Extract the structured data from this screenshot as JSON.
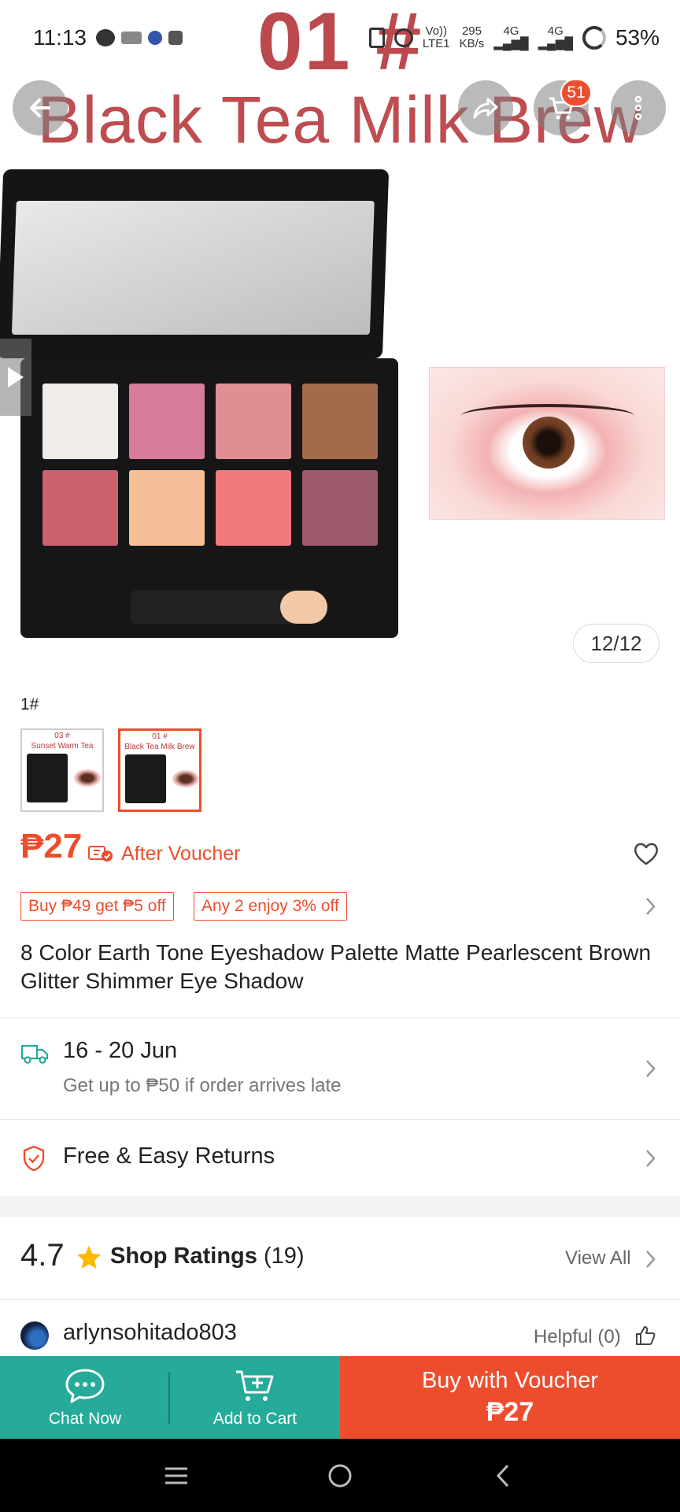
{
  "status_bar": {
    "time": "11:13",
    "net_speed_value": "295",
    "net_speed_unit": "KB/s",
    "volte": "Vo))",
    "lte": "LTE1",
    "signal1": "4G",
    "signal2": "4G",
    "battery": "53%"
  },
  "hero": {
    "overlay_title_line1": "01 #",
    "overlay_title_line2": "Black Tea Milk Brew",
    "cart_badge": "51",
    "image_counter": "12/12"
  },
  "variations": {
    "label": "1#",
    "options": [
      {
        "title_line1": "03 #",
        "title_line2": "Sunset Warm Tea",
        "selected": false
      },
      {
        "title_line1": "01 #",
        "title_line2": "Black Tea Milk Brew",
        "selected": true
      }
    ]
  },
  "price": {
    "amount": "₱27",
    "after_voucher_label": "After Voucher"
  },
  "promos": [
    {
      "label": "Buy ₱49 get ₱5 off"
    },
    {
      "label": "Any 2 enjoy 3% off"
    }
  ],
  "product": {
    "name": "8 Color Earth Tone Eyeshadow Palette Matte Pearlescent Brown Glitter Shimmer Eye Shadow"
  },
  "shipping": {
    "date_range": "16 - 20 Jun",
    "guarantee": "Get up to ₱50 if order arrives late"
  },
  "returns": {
    "label": "Free & Easy Returns"
  },
  "ratings": {
    "score": "4.7",
    "label": "Shop Ratings",
    "count": "(19)",
    "view_all": "View All"
  },
  "review": {
    "username": "arlynsohitado803",
    "helpful": "Helpful (0)"
  },
  "bottom_bar": {
    "chat_label": "Chat Now",
    "cart_label": "Add to Cart",
    "buy_label": "Buy with Voucher",
    "buy_price": "₱27"
  },
  "colors": {
    "accent": "#ee4d2d",
    "teal": "#26aa99",
    "overlay_text": "#b63a3f"
  },
  "icons": {
    "back": "arrow-left-icon",
    "share": "share-icon",
    "cart": "cart-icon",
    "more": "more-vertical-icon",
    "wishlist": "heart-icon",
    "shipping": "truck-icon",
    "returns": "shield-check-icon",
    "rating": "star-icon",
    "helpful": "thumbs-up-icon",
    "chat": "chat-icon",
    "add_cart": "cart-plus-icon"
  }
}
